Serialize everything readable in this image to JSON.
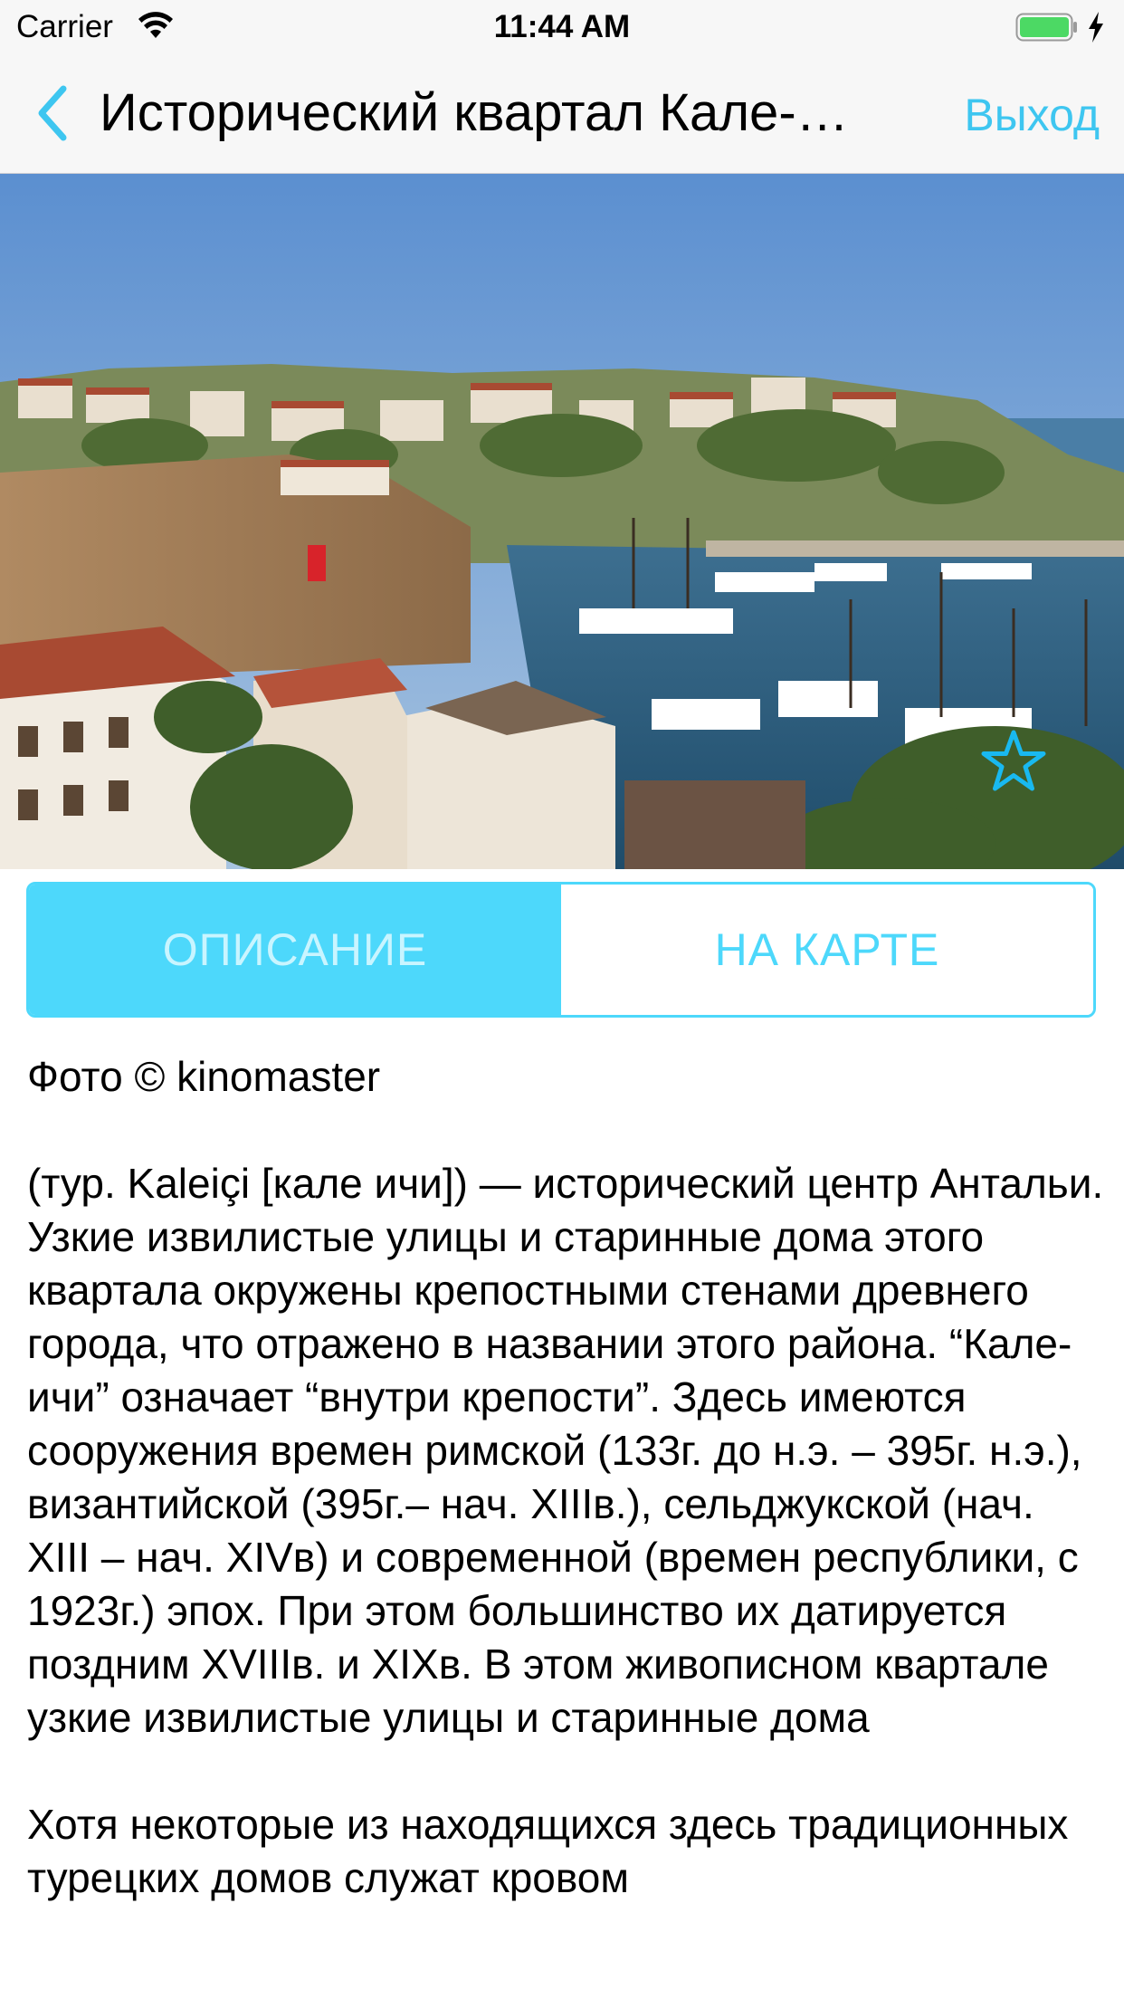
{
  "status_bar": {
    "carrier": "Carrier",
    "time": "11:44 AM",
    "battery_color": "#4cd964"
  },
  "nav": {
    "title": "Исторический квартал Кале-…",
    "exit_label": "Выход",
    "accent_color": "#3ec6f0"
  },
  "hero": {
    "icon": "star-outline-icon"
  },
  "tabs": [
    {
      "label": "ОПИСАНИЕ",
      "active": true
    },
    {
      "label": "НА КАРТЕ",
      "active": false
    }
  ],
  "article": {
    "credit": "Фото © kinomaster",
    "paragraphs": [
      "(тур. Kaleiçi [кале ичи]) — исторический центр Антальи. Узкие извилистые улицы и старинные дома этого квартала окружены крепостными стенами древнего города, что отражено в названии этого района. “Кале-ичи” означает “внутри крепости”. Здесь имеются сооружения времен римской (133г. до н.э. – 395г. н.э.), византийской (395г.– нач. XIIIв.), сельджукской (нач. XIII – нач. XIVв) и современной (времен республики, с 1923г.) эпох. При этом большинство их датируется поздним XVIIIв. и XIXв. В этом живописном квартале узкие извилистые улицы и старинные дома",
      "Хотя некоторые из находящихся здесь традиционных турецких домов служат кровом"
    ]
  }
}
